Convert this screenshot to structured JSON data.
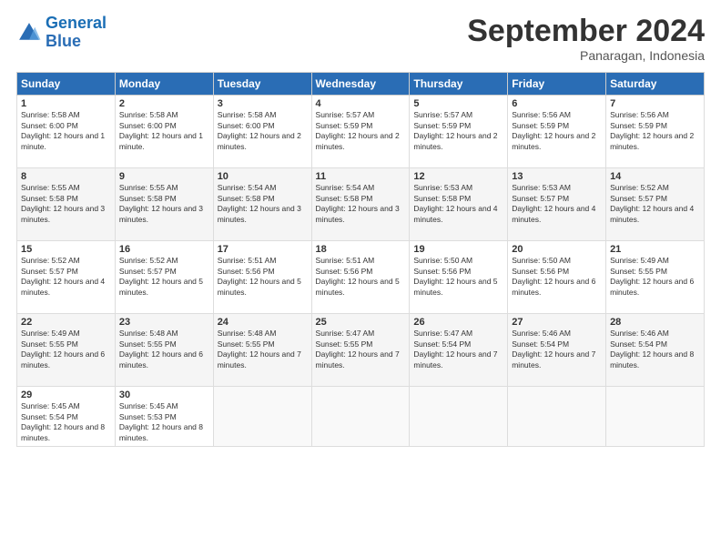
{
  "logo": {
    "text_general": "General",
    "text_blue": "Blue"
  },
  "header": {
    "month": "September 2024",
    "location": "Panaragan, Indonesia"
  },
  "weekdays": [
    "Sunday",
    "Monday",
    "Tuesday",
    "Wednesday",
    "Thursday",
    "Friday",
    "Saturday"
  ],
  "weeks": [
    [
      {
        "day": "1",
        "sunrise": "5:58 AM",
        "sunset": "6:00 PM",
        "daylight": "12 hours and 1 minute."
      },
      {
        "day": "2",
        "sunrise": "5:58 AM",
        "sunset": "6:00 PM",
        "daylight": "12 hours and 1 minute."
      },
      {
        "day": "3",
        "sunrise": "5:58 AM",
        "sunset": "6:00 PM",
        "daylight": "12 hours and 2 minutes."
      },
      {
        "day": "4",
        "sunrise": "5:57 AM",
        "sunset": "5:59 PM",
        "daylight": "12 hours and 2 minutes."
      },
      {
        "day": "5",
        "sunrise": "5:57 AM",
        "sunset": "5:59 PM",
        "daylight": "12 hours and 2 minutes."
      },
      {
        "day": "6",
        "sunrise": "5:56 AM",
        "sunset": "5:59 PM",
        "daylight": "12 hours and 2 minutes."
      },
      {
        "day": "7",
        "sunrise": "5:56 AM",
        "sunset": "5:59 PM",
        "daylight": "12 hours and 2 minutes."
      }
    ],
    [
      {
        "day": "8",
        "sunrise": "5:55 AM",
        "sunset": "5:58 PM",
        "daylight": "12 hours and 3 minutes."
      },
      {
        "day": "9",
        "sunrise": "5:55 AM",
        "sunset": "5:58 PM",
        "daylight": "12 hours and 3 minutes."
      },
      {
        "day": "10",
        "sunrise": "5:54 AM",
        "sunset": "5:58 PM",
        "daylight": "12 hours and 3 minutes."
      },
      {
        "day": "11",
        "sunrise": "5:54 AM",
        "sunset": "5:58 PM",
        "daylight": "12 hours and 3 minutes."
      },
      {
        "day": "12",
        "sunrise": "5:53 AM",
        "sunset": "5:58 PM",
        "daylight": "12 hours and 4 minutes."
      },
      {
        "day": "13",
        "sunrise": "5:53 AM",
        "sunset": "5:57 PM",
        "daylight": "12 hours and 4 minutes."
      },
      {
        "day": "14",
        "sunrise": "5:52 AM",
        "sunset": "5:57 PM",
        "daylight": "12 hours and 4 minutes."
      }
    ],
    [
      {
        "day": "15",
        "sunrise": "5:52 AM",
        "sunset": "5:57 PM",
        "daylight": "12 hours and 4 minutes."
      },
      {
        "day": "16",
        "sunrise": "5:52 AM",
        "sunset": "5:57 PM",
        "daylight": "12 hours and 5 minutes."
      },
      {
        "day": "17",
        "sunrise": "5:51 AM",
        "sunset": "5:56 PM",
        "daylight": "12 hours and 5 minutes."
      },
      {
        "day": "18",
        "sunrise": "5:51 AM",
        "sunset": "5:56 PM",
        "daylight": "12 hours and 5 minutes."
      },
      {
        "day": "19",
        "sunrise": "5:50 AM",
        "sunset": "5:56 PM",
        "daylight": "12 hours and 5 minutes."
      },
      {
        "day": "20",
        "sunrise": "5:50 AM",
        "sunset": "5:56 PM",
        "daylight": "12 hours and 6 minutes."
      },
      {
        "day": "21",
        "sunrise": "5:49 AM",
        "sunset": "5:55 PM",
        "daylight": "12 hours and 6 minutes."
      }
    ],
    [
      {
        "day": "22",
        "sunrise": "5:49 AM",
        "sunset": "5:55 PM",
        "daylight": "12 hours and 6 minutes."
      },
      {
        "day": "23",
        "sunrise": "5:48 AM",
        "sunset": "5:55 PM",
        "daylight": "12 hours and 6 minutes."
      },
      {
        "day": "24",
        "sunrise": "5:48 AM",
        "sunset": "5:55 PM",
        "daylight": "12 hours and 7 minutes."
      },
      {
        "day": "25",
        "sunrise": "5:47 AM",
        "sunset": "5:55 PM",
        "daylight": "12 hours and 7 minutes."
      },
      {
        "day": "26",
        "sunrise": "5:47 AM",
        "sunset": "5:54 PM",
        "daylight": "12 hours and 7 minutes."
      },
      {
        "day": "27",
        "sunrise": "5:46 AM",
        "sunset": "5:54 PM",
        "daylight": "12 hours and 7 minutes."
      },
      {
        "day": "28",
        "sunrise": "5:46 AM",
        "sunset": "5:54 PM",
        "daylight": "12 hours and 8 minutes."
      }
    ],
    [
      {
        "day": "29",
        "sunrise": "5:45 AM",
        "sunset": "5:54 PM",
        "daylight": "12 hours and 8 minutes."
      },
      {
        "day": "30",
        "sunrise": "5:45 AM",
        "sunset": "5:53 PM",
        "daylight": "12 hours and 8 minutes."
      },
      null,
      null,
      null,
      null,
      null
    ]
  ]
}
